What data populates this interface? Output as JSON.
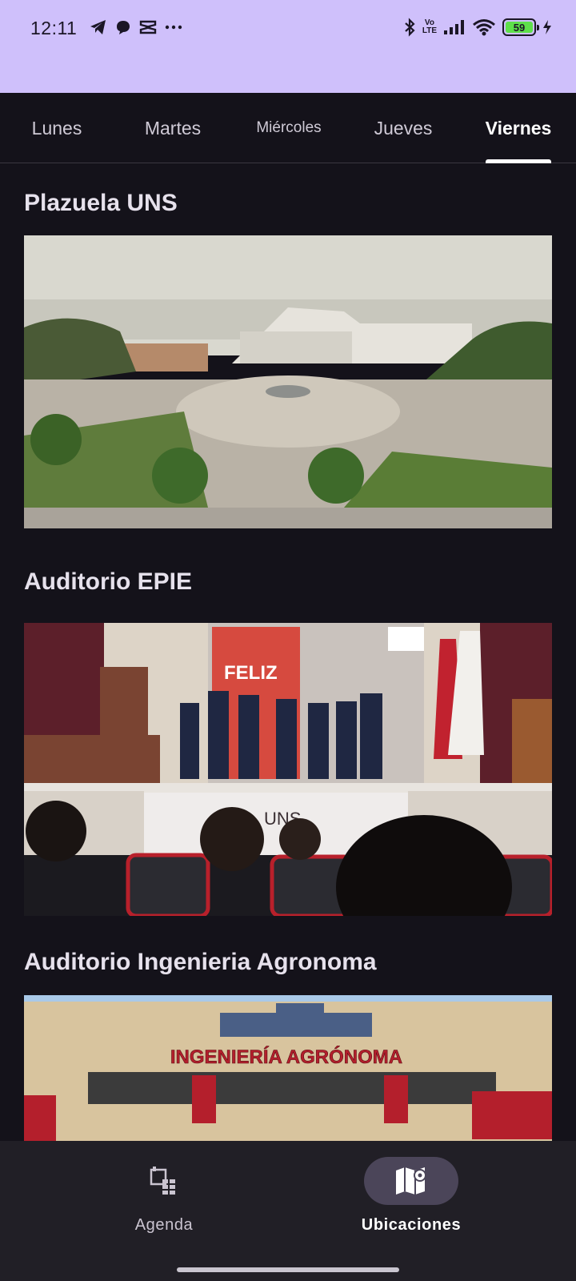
{
  "status_bar": {
    "time": "12:11",
    "battery": "59",
    "icons": [
      "telegram-icon",
      "chat-bubble-icon",
      "capcut-icon",
      "more-dots-icon",
      "bluetooth-icon",
      "volte-icon",
      "signal-icon",
      "wifi-icon",
      "battery-icon",
      "charging-icon"
    ],
    "volte_top": "Vo",
    "volte_bottom": "LTE",
    "background": "#cfc0fb"
  },
  "tabs": [
    {
      "label": "Lunes",
      "active": false
    },
    {
      "label": "Martes",
      "active": false
    },
    {
      "label": "Miércoles",
      "active": false
    },
    {
      "label": "Jueves",
      "active": false
    },
    {
      "label": "Viernes",
      "active": true
    }
  ],
  "locations": [
    {
      "title": "Plazuela UNS",
      "image": "campus-plaza-photo"
    },
    {
      "title": "Auditorio EPIE",
      "image": "auditorium-ceremony-photo",
      "image_texts": [
        "FELIZ",
        "UNS"
      ]
    },
    {
      "title": "Auditorio Ingenieria Agronoma",
      "image": "building-facade-photo",
      "image_texts": [
        "INGENIERÍA AGRÓNOMA"
      ]
    }
  ],
  "bottom_nav": {
    "items": [
      {
        "label": "Agenda",
        "icon": "calendar-grid-icon",
        "active": false
      },
      {
        "label": "Ubicaciones",
        "icon": "map-pin-icon",
        "active": true
      }
    ]
  },
  "colors": {
    "background": "#14121a",
    "nav_background": "#211f26",
    "active_pill": "#4b4559",
    "text": "#e6e1ec"
  }
}
